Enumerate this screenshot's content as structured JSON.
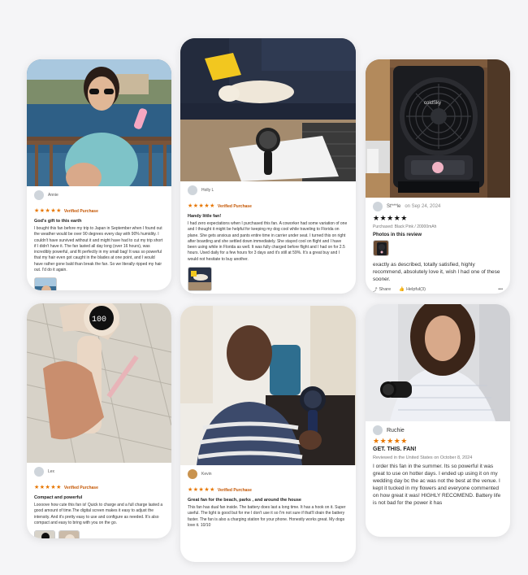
{
  "cards": [
    {
      "reviewer": "Annie",
      "stars": "★★★★★",
      "verified": "Verified Purchase",
      "title": "God's gift to this earth",
      "body": "I bought this fan before my trip to Japan in September when I found out the weather would be over 90 degrees every day with 90% humidity. I couldn't have survived without it and might have had to cut my trip short if I didn't have it. The fan lasted all day long (over 16 hours), was incredibly powerful, and fit perfectly in my small bag! It was so powerful that my hair even got caught in the blades at one point, and I would have rather gone bald than break the fan. So we literally ripped my hair out. I'd do it again."
    },
    {
      "reviewer": "Holly L",
      "stars": "★★★★★",
      "verified": "Verified Purchase",
      "title": "Handy little fan!",
      "body": "I had zero expectations when I purchased this fan. A coworker had some variation of one and I thought it might be helpful for keeping my dog cool while traveling to Florida on plane. She gets anxious and pants entire time in carrier under seat. I turned this on right after boarding and she settled down immediately. She stayed cool on flight and I have been using while in Florida as well. It was fully charged before flight and I had on for 2.5 hours. Used daily for a few hours for 3 days and it's still at 59%. It's a great buy and I would not hesitate to buy another."
    },
    {
      "reviewer": "St***le",
      "reviewed_on": "on Sep 24, 2024",
      "stars": "★★★★★",
      "purchased": "Purchased: Black Pink / 20000mAh",
      "photos_label": "Photos in this review",
      "body": "exactly as described, totally satisfied, highly recommend, absolutely love it, wish I had one of these sooner.",
      "share": "Share",
      "helpful": "Helpful(3)",
      "more": "•••"
    },
    {
      "reviewer": "Lex",
      "stars": "★★★★★",
      "verified": "Verified Purchase",
      "title": "Compact and powerful",
      "body": "Loooove how cute this fan is! Quick to charge and a full charge lasted a good amount of time.The digital screen makes it easy to adjust the intensity. And it's pretty easy to use and configure as needed. It's also compact and easy to bring with you on the go."
    },
    {
      "reviewer": "Kevin",
      "stars": "★★★★★",
      "verified": "Verified Purchase",
      "title": "Great fan for the beach, parks , and around the house",
      "body": "This fan has dual fan inside. The battery does last a long time. It has a hook on it. Super useful. The light is good but for me I don't use it so I'm not sure if that'll drain the battery faster. The fan is also a charging station for your phone. Honestly works great. My dogs love it. 10/10"
    },
    {
      "reviewer": "Ruchie",
      "stars": "★★★★★",
      "title": "GET. THIS. FAN!",
      "reviewed_in": "Reviewed in the United States on October 8, 2024",
      "body": "I order this fan in the summer. Its so powerful it was great to use on hotter days. I ended up using it on my wedding day bc the ac was not the best at the venue. I kept it tucked in my flowers and everyone commented on how great it was! HIGHLY RECOMEND. Battery life is not bad for the power it has"
    }
  ],
  "device_display": "100",
  "brand_label": "coldSky"
}
